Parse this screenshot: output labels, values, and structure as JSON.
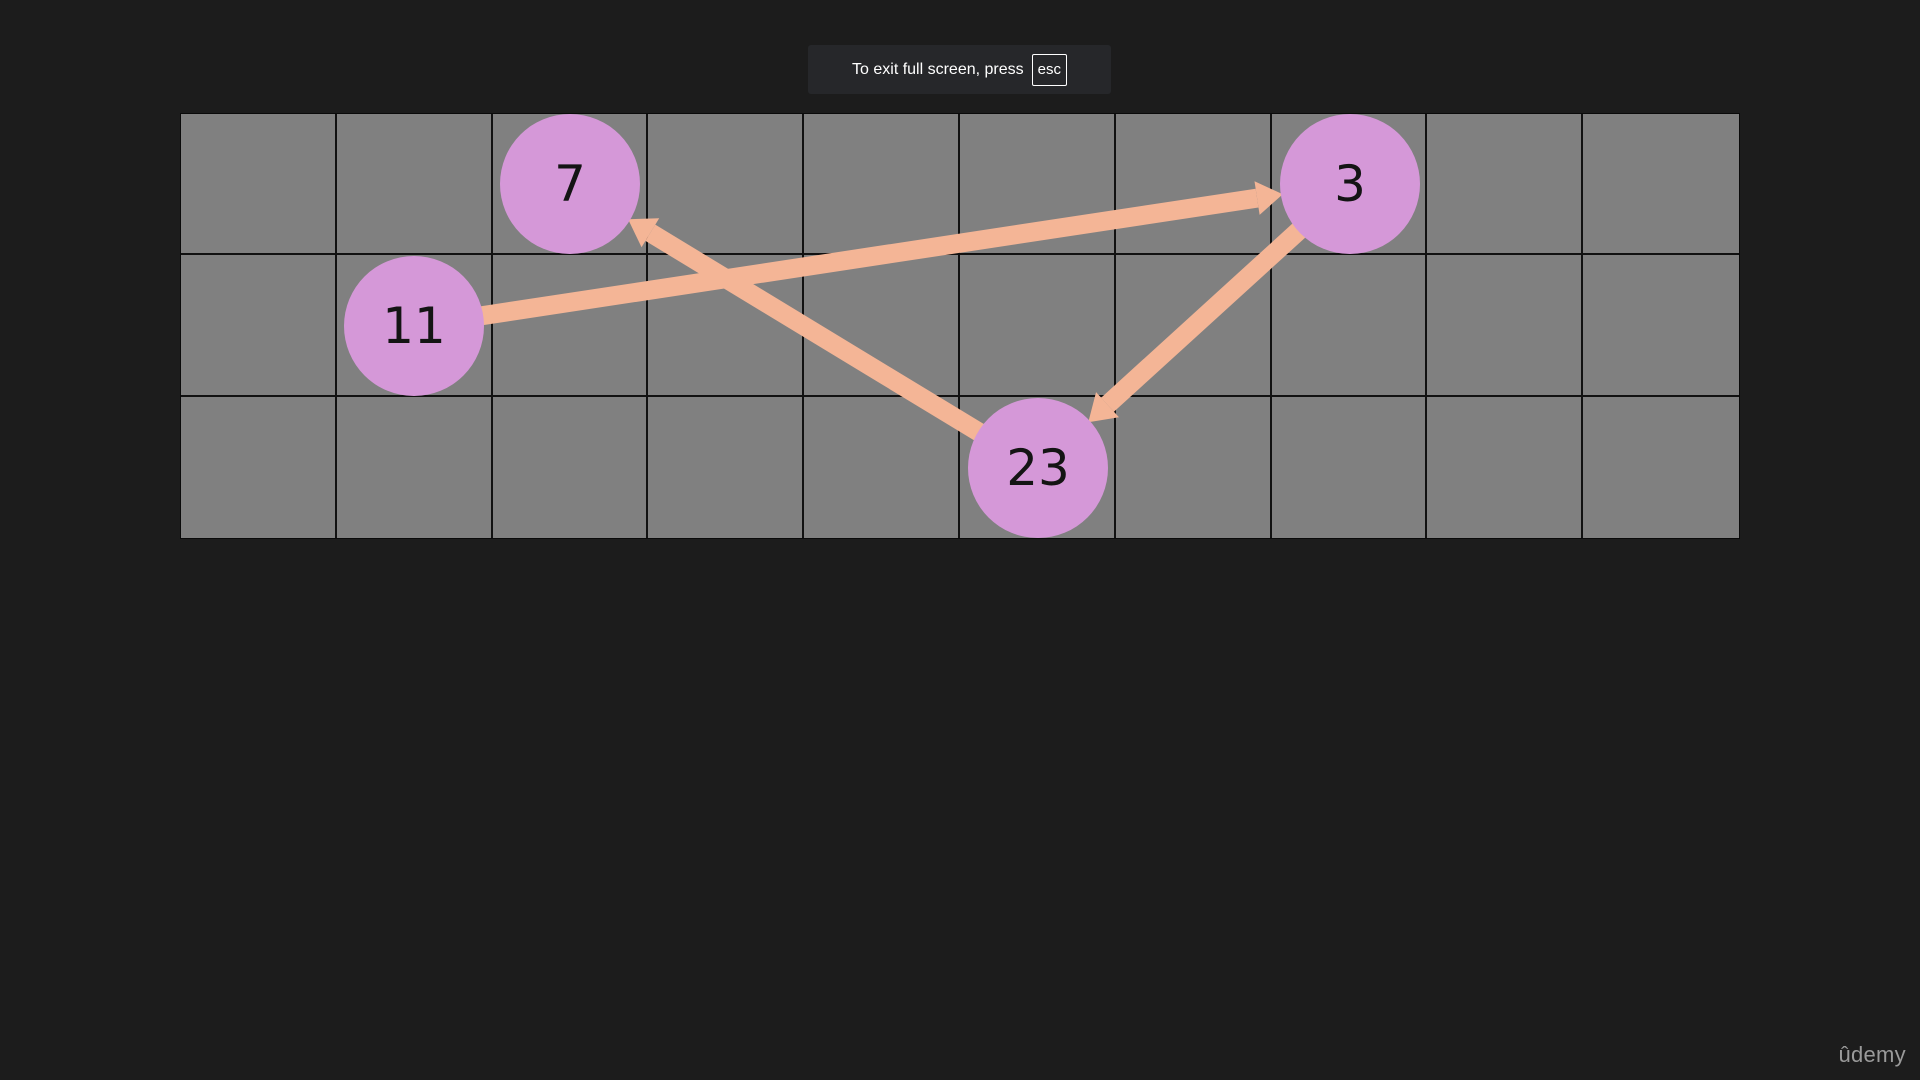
{
  "fullscreen_banner": {
    "message": "To exit full screen, press",
    "key_label": "esc"
  },
  "grid": {
    "rows": 3,
    "columns": 10,
    "cell_color": "#808080"
  },
  "nodes": [
    {
      "id": "node-7",
      "label": "7",
      "row": 0,
      "col": 2,
      "color": "#d598d8"
    },
    {
      "id": "node-3",
      "label": "3",
      "row": 0,
      "col": 7,
      "color": "#d598d8"
    },
    {
      "id": "node-11",
      "label": "11",
      "row": 1,
      "col": 1,
      "color": "#d598d8"
    },
    {
      "id": "node-23",
      "label": "23",
      "row": 2,
      "col": 5,
      "color": "#d598d8"
    }
  ],
  "arrows": [
    {
      "from": "11",
      "to": "3",
      "color": "#f4b596"
    },
    {
      "from": "3",
      "to": "23",
      "color": "#f4b596"
    },
    {
      "from": "23",
      "to": "7",
      "color": "#f4b596"
    }
  ],
  "watermark": {
    "text": "ûdemy"
  }
}
